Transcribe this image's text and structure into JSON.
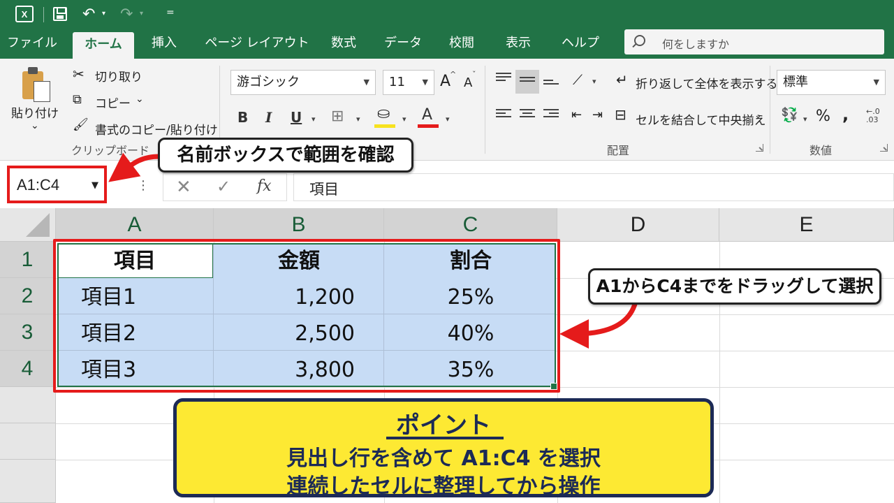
{
  "titlebar": {
    "logo_text": "X",
    "undo_symbol": "↶",
    "redo_symbol": "↷",
    "dropdown_symbol": "▾",
    "customize_symbol": "="
  },
  "tabs": [
    "ファイル",
    "ホーム",
    "挿入",
    "ページ レイアウト",
    "数式",
    "データ",
    "校閲",
    "表示",
    "ヘルプ"
  ],
  "active_tab": "ホーム",
  "tell_me": {
    "placeholder": "何をしますか"
  },
  "ribbon": {
    "clipboard": {
      "paste_label": "貼り付け",
      "paste_arrow": "⌄",
      "cut_label": "切り取り",
      "copy_label": "コピー",
      "copy_arrow": "⌄",
      "format_painter_label": "書式のコピー/貼り付け",
      "group_label": "クリップボード"
    },
    "font": {
      "font_name": "游ゴシック",
      "font_size": "11",
      "grow_label": "A",
      "shrink_label": "A",
      "bold_label": "B",
      "italic_label": "I",
      "underline_label": "U",
      "font_color_label": "A",
      "fill_color": "#f7e21f",
      "font_color": "#e51b1b"
    },
    "alignment": {
      "wrap_text_label": "折り返して全体を表示する",
      "merge_center_label": "セルを結合して中央揃え",
      "merge_arrow": "⌄",
      "group_label": "配置"
    },
    "number": {
      "format": "標準",
      "percent_label": "%",
      "comma_label": ",",
      "decimal_label": "←.0\n.03",
      "group_label": "数値"
    }
  },
  "formula_bar": {
    "name_box_value": "A1:C4",
    "cancel_symbol": "✕",
    "enter_symbol": "✓",
    "fx_label": "fx",
    "more_symbol": "⋮",
    "formula_value": "項目"
  },
  "grid": {
    "columns": [
      "A",
      "B",
      "C",
      "D",
      "E"
    ],
    "rows": [
      "1",
      "2",
      "3",
      "4"
    ],
    "cells": [
      [
        "項目",
        "金額",
        "割合"
      ],
      [
        "項目1",
        "1,200",
        "25%"
      ],
      [
        "項目2",
        "2,500",
        "40%"
      ],
      [
        "項目3",
        "3,800",
        "35%"
      ]
    ]
  },
  "callouts": {
    "namebox": "名前ボックスで範囲を確認",
    "drag": "A1からC4までをドラッグして選択"
  },
  "point_box": {
    "title": "ポイント",
    "line1": "見出し行を含めて A1:C4 を選択",
    "line2": "連続したセルに整理してから操作"
  },
  "colors": {
    "excel_green": "#217346",
    "selection_fill": "#c7dcf5",
    "annotation_red": "#e51b1b",
    "point_yellow": "#fde933",
    "point_navy": "#1c2a56"
  }
}
